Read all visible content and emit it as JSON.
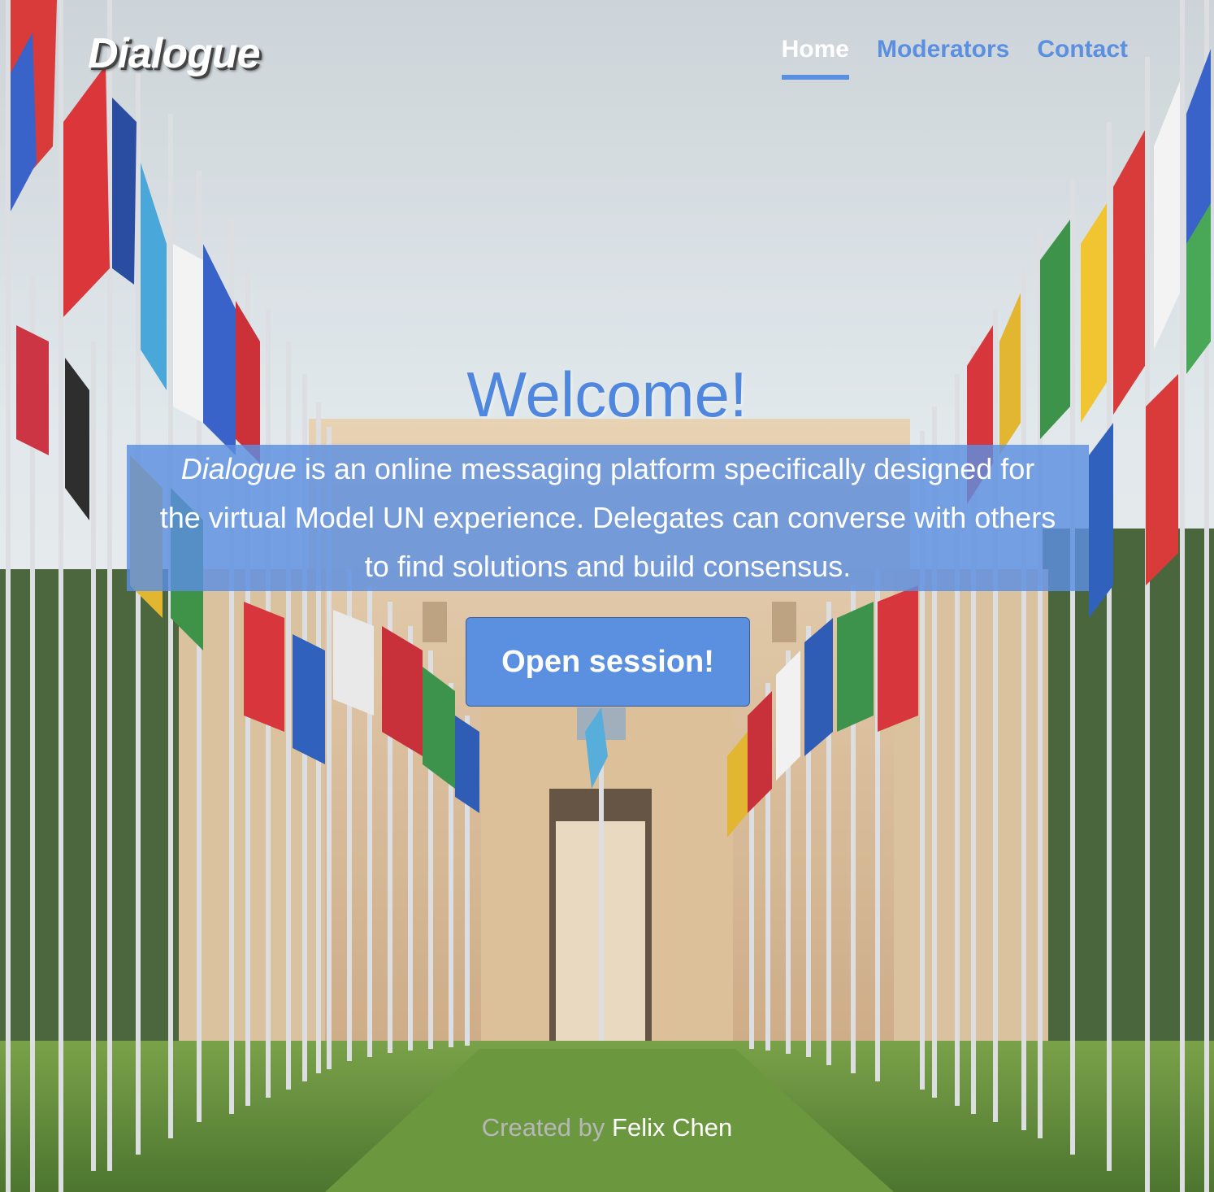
{
  "brand": "Dialogue",
  "nav": {
    "home": "Home",
    "moderators": "Moderators",
    "contact": "Contact",
    "active": "Home"
  },
  "hero": {
    "title": "Welcome!",
    "description_brand": "Dialogue",
    "description_rest": " is an online messaging platform specifically designed for the virtual Model UN experience. Delegates can converse with others to find solutions and build consensus.",
    "cta_label": "Open session!"
  },
  "footer": {
    "prefix": "Created by ",
    "author": "Felix Chen"
  },
  "colors": {
    "accent": "#5b8fe0",
    "text_light": "#ffffff",
    "muted": "#b7b7b7"
  },
  "background": "photo-un-flags-avenue"
}
